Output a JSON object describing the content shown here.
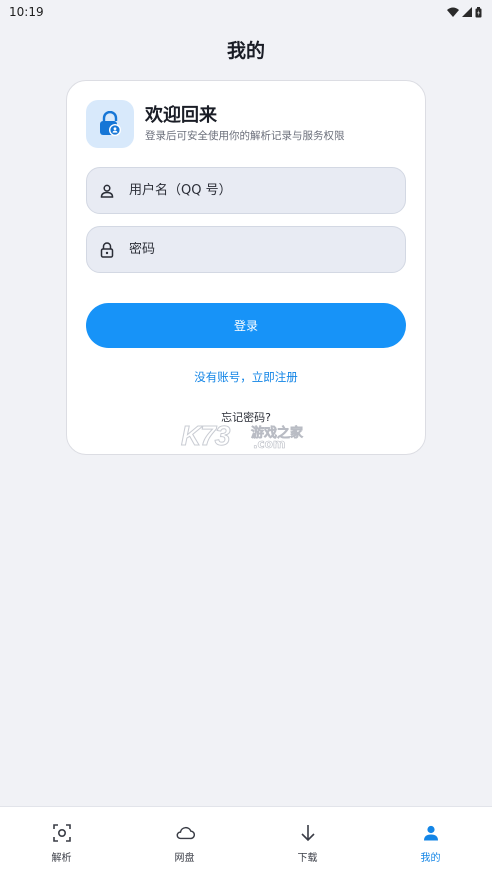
{
  "status_bar": {
    "time": "10:19"
  },
  "page": {
    "title": "我的"
  },
  "login_card": {
    "title": "欢迎回来",
    "subtitle": "登录后可安全使用你的解析记录与服务权限",
    "username_placeholder": "用户名（QQ 号）",
    "password_placeholder": "密码",
    "login_label": "登录",
    "register_link": "没有账号，立即注册",
    "forgot_link": "忘记密码?"
  },
  "watermark": {
    "brand": "K73",
    "cn": "游戏之家",
    "domain": ".com"
  },
  "bottom_nav": {
    "items": [
      {
        "label": "解析",
        "icon": "scan-icon"
      },
      {
        "label": "网盘",
        "icon": "cloud-icon"
      },
      {
        "label": "下载",
        "icon": "download-icon"
      },
      {
        "label": "我的",
        "icon": "user-icon",
        "active": true
      }
    ]
  },
  "colors": {
    "accent": "#1793f8",
    "link": "#1385e6",
    "background": "#f1f2f6",
    "input_bg": "#e8ebf3"
  }
}
